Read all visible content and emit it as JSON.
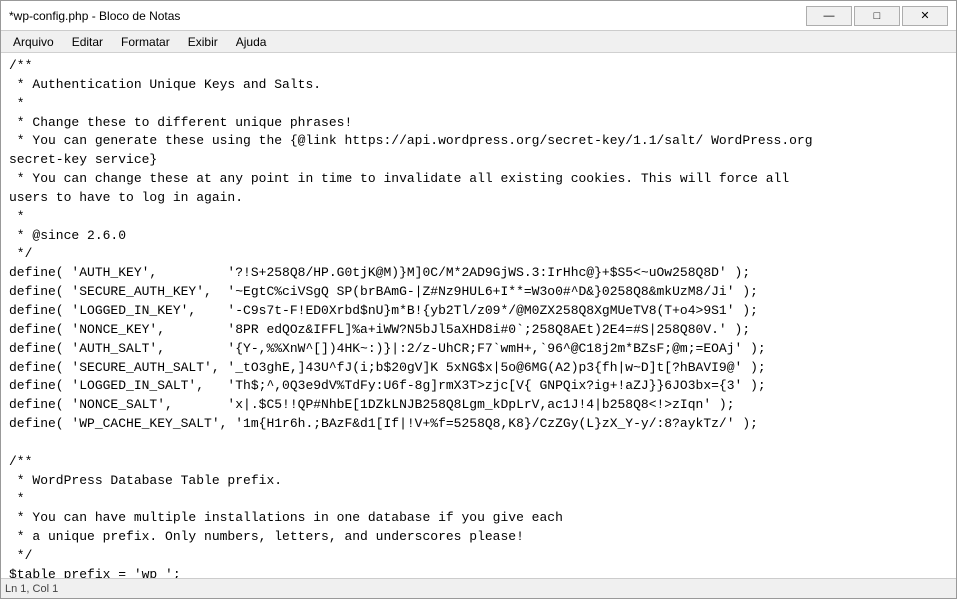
{
  "window": {
    "title": "*wp-config.php - Bloco de Notas"
  },
  "title_buttons": {
    "minimize": "—",
    "maximize": "□",
    "close": "✕"
  },
  "menu": {
    "items": [
      "Arquivo",
      "Editar",
      "Formatar",
      "Exibir",
      "Ajuda"
    ]
  },
  "code": {
    "lines": [
      "/**",
      " * Authentication Unique Keys and Salts.",
      " *",
      " * Change these to different unique phrases!",
      " * You can generate these using the {@link https://api.wordpress.org/secret-key/1.1/salt/ WordPress.org",
      "secret-key service}",
      " * You can change these at any point in time to invalidate all existing cookies. This will force all",
      "users to have to log in again.",
      " *",
      " * @since 2.6.0",
      " */",
      "define( 'AUTH_KEY',         '?!S+258Q8/HP.G0tjK@M)}M]0C/M*2AD9GjWS.3:IrHhc@}+$S5<~uOw258Q8D' );",
      "define( 'SECURE_AUTH_KEY',  '~EgtC%ciVSgQ SP(brBAmG-|Z#Nz9HUL6+I**=W3o0#^D&}0258Q8&mkUzM8/Ji' );",
      "define( 'LOGGED_IN_KEY',    '-C9s7t-F!ED0Xrbd$nU}m*B!{yb2Tl/z09*/@M0ZX258Q8XgMUeTV8(T+o4>9S1' );",
      "define( 'NONCE_KEY',        '8PR edQOz&IFFL]%a+iWW?N5bJl5aXHD8i#0`;258Q8AEt)2E4=#S|258Q80V.' );",
      "define( 'AUTH_SALT',        '{Y-,%%XnW^[])4HK~:)}|:2/z-UhCR;F7`wmH+,`96^@C18j2m*BZsF;@m;=EOAj' );",
      "define( 'SECURE_AUTH_SALT', '_tO3ghE,]43U^fJ(i;b$20gV]K 5xNG$x|5o@6MG(A2)p3{fh|w~D]t[?hBAVI9@' );",
      "define( 'LOGGED_IN_SALT',   'Th$;^,0Q3e9dV%TdFy:U6f-8g]rmX3T>zjc[V{ GNPQix?ig+!aZJ}}6JO3bx={3' );",
      "define( 'NONCE_SALT',       'x|.$C5!!QP#NhbE[1DZkLNJB258Q8Lgm_kDpLrV,ac1J!4|b258Q8<!>zIqn' );",
      "define( 'WP_CACHE_KEY_SALT', '1m{H1r6h.;BAzF&d1[If|!V+%f=5258Q8,K8}/CzZGy(L}zX_Y-y/:8?aykTz/' );",
      "",
      "/**",
      " * WordPress Database Table prefix.",
      " *",
      " * You can have multiple installations in one database if you give each",
      " * a unique prefix. Only numbers, letters, and underscores please!",
      " */",
      "$table_prefix = 'wp_';"
    ]
  }
}
